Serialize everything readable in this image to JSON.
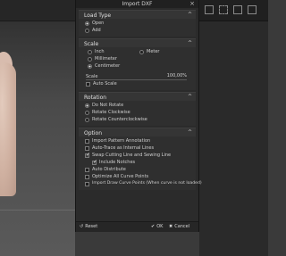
{
  "dialog": {
    "title": "Import DXF",
    "close_glyph": "×"
  },
  "sections": {
    "load_type": {
      "title": "Load Type",
      "options": [
        "Open",
        "Add"
      ],
      "selected": "Open"
    },
    "scale": {
      "title": "Scale",
      "units": [
        "Inch",
        "Meter",
        "Millimeter",
        "Centimeter"
      ],
      "selected": "Centimeter",
      "scale_label": "Scale",
      "scale_value": "100,00%",
      "auto_scale_label": "Auto Scale",
      "auto_scale_checked": false
    },
    "rotation": {
      "title": "Rotation",
      "options": [
        "Do Not Rotate",
        "Rotate Clockwise",
        "Rotate Counterclockwise"
      ],
      "selected": "Do Not Rotate"
    },
    "option": {
      "title": "Option",
      "items": [
        {
          "label": "Import Pattern Annotation",
          "checked": false
        },
        {
          "label": "Auto-Trace as Internal Lines",
          "checked": false
        },
        {
          "label": "Swap Cutting Line and Sewing Line",
          "checked": true
        },
        {
          "label": "Include Notches",
          "checked": true
        },
        {
          "label": "Auto Distribute",
          "checked": false
        },
        {
          "label": "Optimize All Curve Points",
          "checked": false
        },
        {
          "label": "Import Draw Curve Points (When curve is not loaded)",
          "checked": false
        }
      ]
    }
  },
  "footer": {
    "reset_label": "Reset",
    "ok_label": "OK",
    "cancel_label": "Cancel",
    "reset_icon": "↺",
    "ok_icon": "✔",
    "cancel_icon": "✖"
  },
  "chevron_glyph": "^"
}
